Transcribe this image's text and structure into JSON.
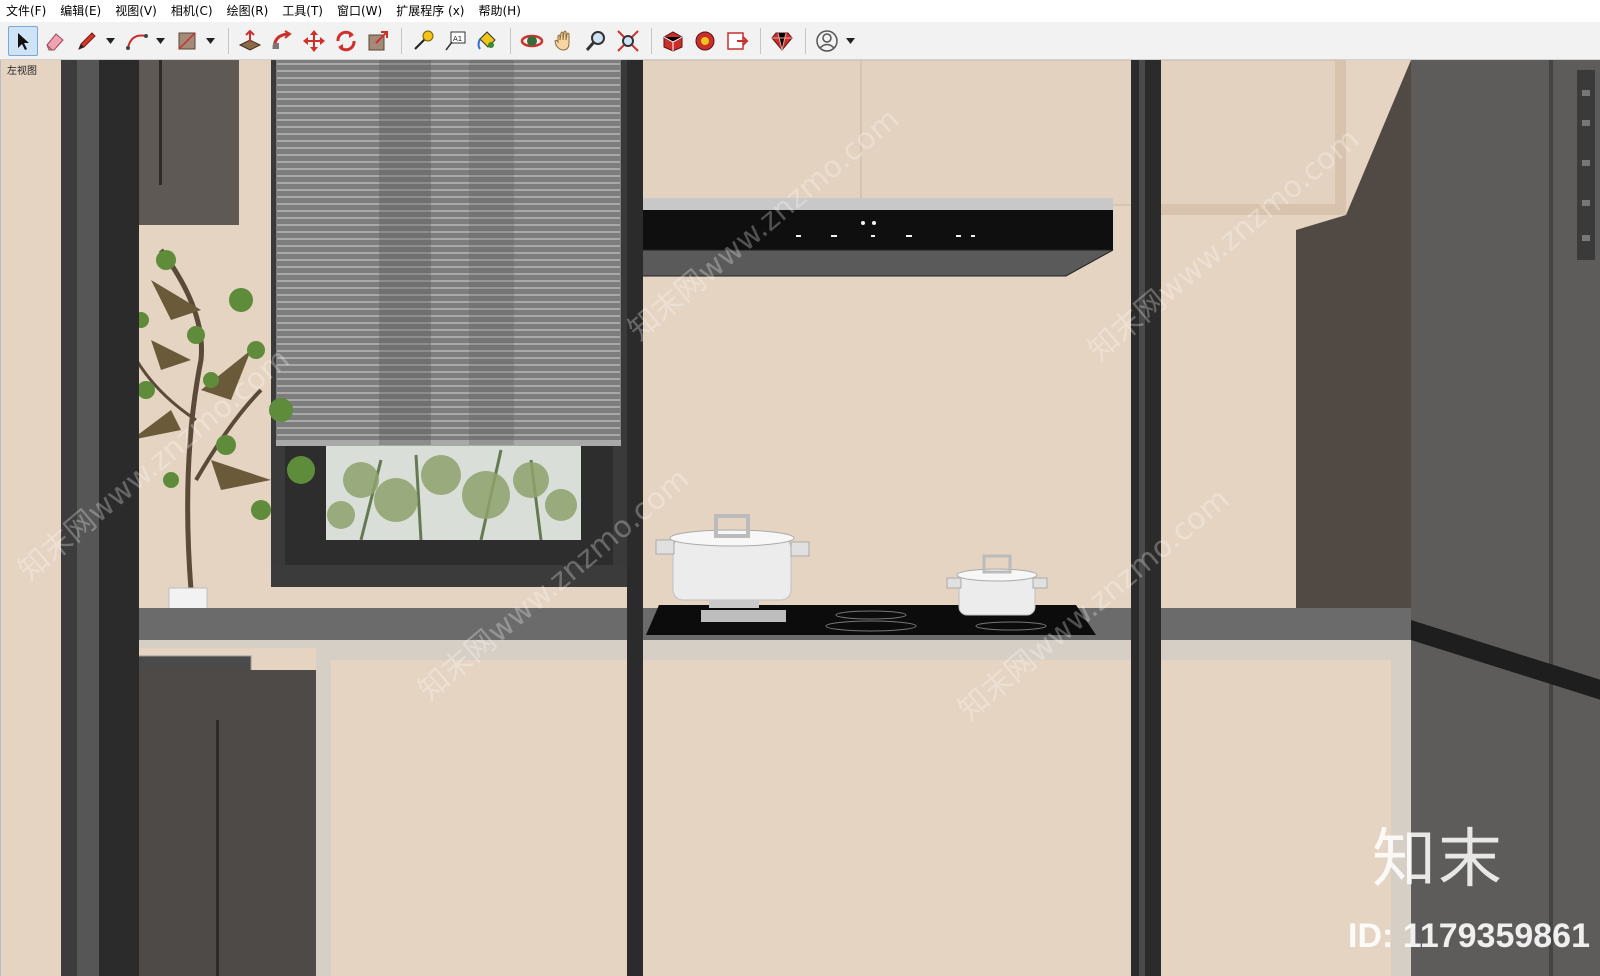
{
  "menu": {
    "items": [
      "文件(F)",
      "编辑(E)",
      "视图(V)",
      "相机(C)",
      "绘图(R)",
      "工具(T)",
      "窗口(W)",
      "扩展程序 (x)",
      "帮助(H)"
    ]
  },
  "toolbar": {
    "tools": [
      {
        "name": "select-tool",
        "icon": "cursor-arrow"
      },
      {
        "name": "eraser-tool",
        "icon": "eraser"
      },
      {
        "name": "line-tool",
        "icon": "pencil"
      },
      {
        "name": "arc-tool",
        "icon": "arc"
      },
      {
        "name": "shape-tool",
        "icon": "rectangle"
      },
      {
        "name": "push-pull-tool",
        "icon": "push-pull"
      },
      {
        "name": "follow-me-tool",
        "icon": "follow-me"
      },
      {
        "name": "move-tool",
        "icon": "move-arrows"
      },
      {
        "name": "rotate-tool",
        "icon": "rotate"
      },
      {
        "name": "scale-tool",
        "icon": "scale"
      },
      {
        "name": "tape-measure-tool",
        "icon": "tape-measure"
      },
      {
        "name": "text-tool",
        "icon": "text-label"
      },
      {
        "name": "paint-bucket-tool",
        "icon": "paint-bucket"
      },
      {
        "name": "orbit-tool",
        "icon": "orbit"
      },
      {
        "name": "pan-tool",
        "icon": "hand"
      },
      {
        "name": "zoom-tool",
        "icon": "magnifier"
      },
      {
        "name": "zoom-extents-tool",
        "icon": "zoom-extents"
      },
      {
        "name": "3d-warehouse-button",
        "icon": "warehouse"
      },
      {
        "name": "extension-warehouse-button",
        "icon": "extension-warehouse"
      },
      {
        "name": "send-to-layout-button",
        "icon": "layout"
      },
      {
        "name": "ruby-console-button",
        "icon": "ruby-gem"
      },
      {
        "name": "account-button",
        "icon": "user-circle"
      }
    ]
  },
  "viewport": {
    "scene_label": "左视图",
    "watermark_text": "知末网www.znzmo.com",
    "brand": "知末",
    "brand_id": "ID: 1179359861"
  },
  "colors": {
    "wall": "#e5d4c2",
    "frame_dark": "#2b2b2b",
    "counter": "#6b6b6b",
    "fridge": "#5e5c5a",
    "toolbar_bg": "#f2f2f2"
  }
}
